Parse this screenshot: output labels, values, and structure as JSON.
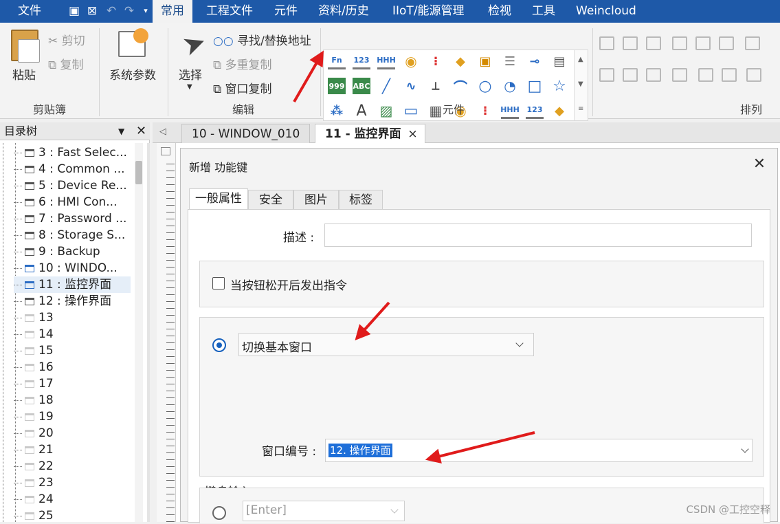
{
  "menubar": {
    "items": [
      "文件",
      "常用",
      "工程文件",
      "元件",
      "资料/历史",
      "IIoT/能源管理",
      "检视",
      "工具",
      "Weincloud"
    ],
    "active": "常用"
  },
  "ribbon": {
    "clipboard": {
      "paste": "粘贴",
      "cut": "剪切",
      "copy": "复制",
      "group_label": "剪贴簿"
    },
    "system": {
      "params": "系统参数"
    },
    "edit": {
      "select": "选择",
      "find_replace": "寻找/替换地址",
      "multi_copy": "多重复制",
      "window_copy": "窗口复制",
      "group_label": "编辑"
    },
    "components": {
      "group_label": "元件",
      "gallery_row1": [
        "Fn",
        "123",
        "HHH",
        "",
        "",
        "",
        "",
        "",
        "",
        ""
      ],
      "gallery_row2": [
        "999",
        "ABC",
        "",
        "",
        "",
        "",
        "",
        "",
        "",
        ""
      ],
      "gallery_row3": [
        "",
        "A",
        "",
        "",
        "",
        "",
        "",
        "",
        "123",
        ""
      ]
    },
    "arrange": {
      "group_label": "排列"
    }
  },
  "tree": {
    "title": "目录树",
    "items": [
      "3 : Fast Selec...",
      "4 : Common ...",
      "5 : Device Re...",
      "6 : HMI Con...",
      "7 : Password ...",
      "8 : Storage S...",
      "9 : Backup",
      "10 : WINDO...",
      "11 : 监控界面",
      "12 : 操作界面",
      "13",
      "14",
      "15",
      "16",
      "17",
      "18",
      "19",
      "20",
      "21",
      "22",
      "23",
      "24",
      "25"
    ]
  },
  "tabs": [
    {
      "label": "10 - WINDOW_010"
    },
    {
      "label": "11 - 监控界面",
      "close": "×"
    }
  ],
  "dialog": {
    "title": "新增 功能键",
    "close": "✕",
    "tabs": [
      "一般属性",
      "安全",
      "图片",
      "标签"
    ],
    "description_label": "描述 :",
    "description_value": "",
    "checkbox_label": "当按钮松开后发出指令",
    "action_select": "切换基本窗口",
    "window_no_label": "窗口编号 :",
    "window_no_value": "12. 操作界面",
    "keyboard_label": "键盘输入",
    "keyboard_select": "[Enter]"
  },
  "watermark": "CSDN @工控空释",
  "colors": {
    "menubar": "#1e59a8",
    "accent": "#1560bd",
    "arrow": "#e01b1b"
  }
}
